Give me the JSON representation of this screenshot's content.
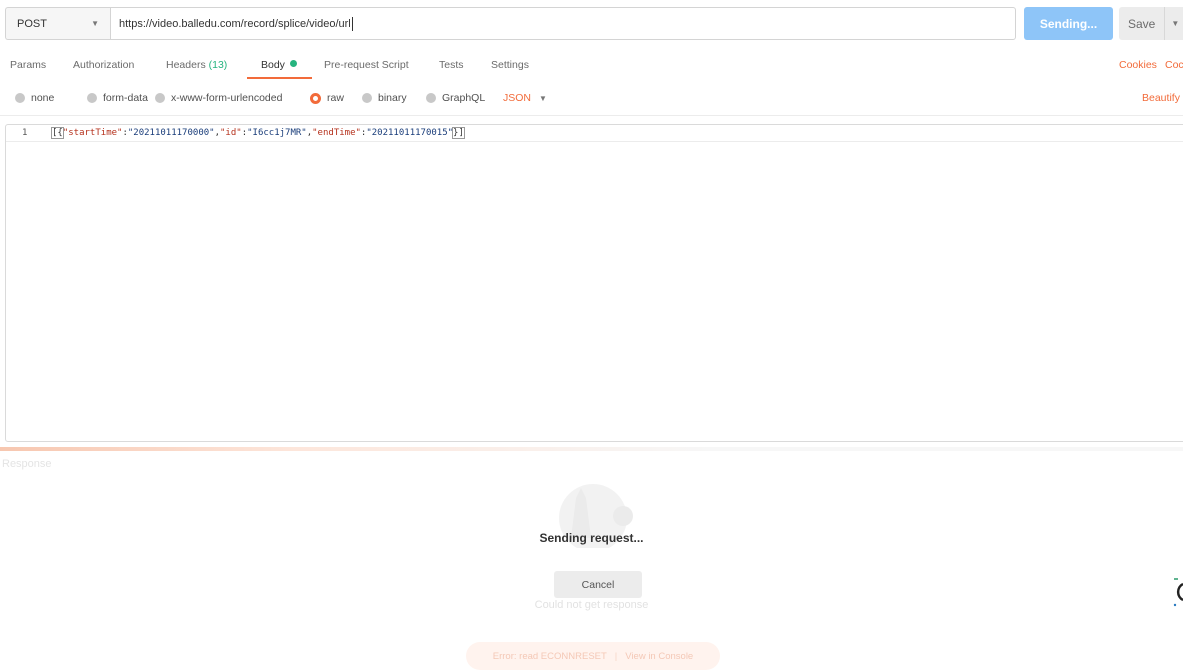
{
  "request": {
    "method": "POST",
    "url": "https://video.balledu.com/record/splice/video/url",
    "send_label": "Sending...",
    "save_label": "Save"
  },
  "tabs": [
    {
      "label": "Params"
    },
    {
      "label": "Authorization"
    },
    {
      "label": "Headers",
      "count": "(13)"
    },
    {
      "label": "Body",
      "active": true
    },
    {
      "label": "Pre-request Script"
    },
    {
      "label": "Tests"
    },
    {
      "label": "Settings"
    }
  ],
  "right_links": {
    "cookies": "Cookies",
    "code": "Coc"
  },
  "body_types": [
    {
      "label": "none"
    },
    {
      "label": "form-data"
    },
    {
      "label": "x-www-form-urlencoded"
    },
    {
      "label": "raw",
      "selected": true
    },
    {
      "label": "binary"
    },
    {
      "label": "GraphQL"
    }
  ],
  "format": {
    "label": "JSON",
    "beautify": "Beautify"
  },
  "editor": {
    "line_number": "1",
    "tokens": [
      "[{",
      "\"startTime\"",
      ":",
      "\"20211011170000\"",
      ",",
      "\"id\"",
      ":",
      "\"I6cc1j7MR\"",
      ",",
      "\"endTime\"",
      ":",
      "\"20211011170015\"",
      "}]"
    ]
  },
  "response": {
    "label": "Response",
    "sending_text": "Sending request...",
    "cancel_label": "Cancel",
    "error_text": "Could not get response",
    "error_detail": "Error: read ECONNRESET",
    "console_link": "View in Console"
  },
  "colors": {
    "accent": "#f26b3a",
    "send_button": "#8ec5f8",
    "active_dot": "#26b47f",
    "json_key": "#b5311c",
    "json_string": "#1a3d7a"
  }
}
